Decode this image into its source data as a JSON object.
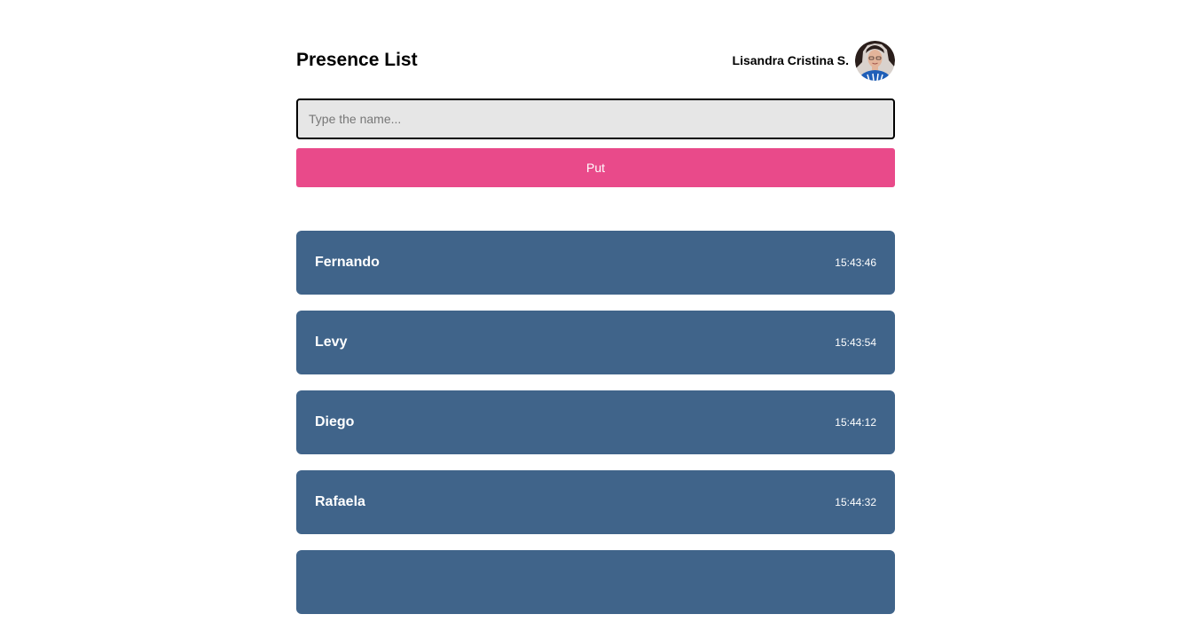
{
  "header": {
    "title": "Presence List",
    "user_name": "Lisandra Cristina S.",
    "avatar_icon": "user-avatar"
  },
  "form": {
    "input_value": "",
    "placeholder": "Type the name...",
    "button_label": "Put"
  },
  "colors": {
    "accent": "#e94a8a",
    "card": "#40648a",
    "input_bg": "#e6e6e6"
  },
  "students": [
    {
      "name": "Fernando",
      "time": "15:43:46"
    },
    {
      "name": "Levy",
      "time": "15:43:54"
    },
    {
      "name": "Diego",
      "time": "15:44:12"
    },
    {
      "name": "Rafaela",
      "time": "15:44:32"
    },
    {
      "name": "",
      "time": ""
    }
  ]
}
